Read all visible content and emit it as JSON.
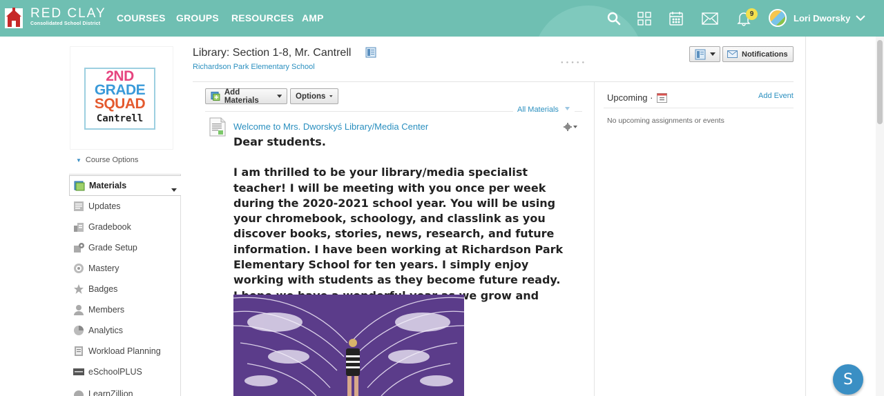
{
  "brand": {
    "name": "RED CLAY",
    "subtitle": "Consolidated School District"
  },
  "nav": {
    "courses": "COURSES",
    "groups": "GROUPS",
    "resources": "RESOURCES",
    "amp": "AMP"
  },
  "header_icons": [
    "search-icon",
    "apps-grid-icon",
    "calendar-icon",
    "mail-icon",
    "bell-icon"
  ],
  "notifications_badge": "9",
  "user": {
    "name": "Lori Dworsky"
  },
  "course_card": {
    "line1": "2ND",
    "line2": "GRADE",
    "line3": "SQUAD",
    "name": "Cantrell"
  },
  "course_options_label": "Course Options",
  "sidebar": {
    "items": [
      {
        "label": "Materials",
        "icon": "materials-icon",
        "active": true
      },
      {
        "label": "Updates",
        "icon": "updates-icon"
      },
      {
        "label": "Gradebook",
        "icon": "gradebook-icon"
      },
      {
        "label": "Grade Setup",
        "icon": "grade-setup-icon"
      },
      {
        "label": "Mastery",
        "icon": "mastery-icon"
      },
      {
        "label": "Badges",
        "icon": "badge-icon"
      },
      {
        "label": "Members",
        "icon": "members-icon"
      },
      {
        "label": "Analytics",
        "icon": "analytics-icon"
      },
      {
        "label": "Workload Planning",
        "icon": "workload-icon"
      },
      {
        "label": "eSchoolPLUS",
        "icon": "eschool-icon"
      },
      {
        "label": "LearnZillion",
        "icon": "learnzillion-icon"
      }
    ]
  },
  "page": {
    "title": "Library: Section 1-8, Mr. Cantrell",
    "school": "Richardson Park Elementary School",
    "notifications_label": "Notifications"
  },
  "toolbar": {
    "add_materials": "Add Materials",
    "options": "Options",
    "filter": "All Materials"
  },
  "post": {
    "title": "Welcome to Mrs. Dworskyś Library/Media Center",
    "greeting": "Dear students.",
    "body": "I am thrilled to be your library/media specialist teacher! I will be meeting with you once per week during the 2020-2021 school year. You will be using your chromebook, schoology, and classlink as you discover books, stories, news, research, and future information. I have been working at Richardson Park Elementary School for ten years. I simply enjoy working with students as they become future ready. I hope we have a wonderful year as we grow and learn together!"
  },
  "upcoming": {
    "title": "Upcoming ·",
    "add_event": "Add Event",
    "empty": "No upcoming assignments or events"
  },
  "help_button": "S",
  "colors": {
    "header": "#6fbfb2",
    "link": "#2a8fbf",
    "help": "#3a8fc4",
    "badge": "#f4e04d"
  }
}
